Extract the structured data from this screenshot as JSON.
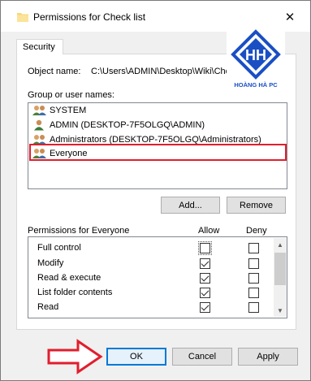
{
  "window": {
    "title": "Permissions for Check list",
    "close_glyph": "✕",
    "folder_icon": "folder-icon",
    "close_icon": "close-icon"
  },
  "tabs": [
    {
      "label": "Security"
    }
  ],
  "object": {
    "label": "Object name:",
    "value": "C:\\Users\\ADMIN\\Desktop\\Wiki\\Check l"
  },
  "groups": {
    "label": "Group or user names:",
    "items": [
      {
        "name": "SYSTEM",
        "icon": "users-icon"
      },
      {
        "name": "ADMIN (DESKTOP-7F5OLGQ\\ADMIN)",
        "icon": "user-icon"
      },
      {
        "name": "Administrators (DESKTOP-7F5OLGQ\\Administrators)",
        "icon": "users-icon"
      },
      {
        "name": "Everyone",
        "icon": "users-icon",
        "selected": true
      }
    ],
    "highlight_color": "#e11e2d"
  },
  "buttons": {
    "add": "Add...",
    "remove": "Remove",
    "ok": "OK",
    "cancel": "Cancel",
    "apply": "Apply"
  },
  "permissions": {
    "label": "Permissions for Everyone",
    "allow_header": "Allow",
    "deny_header": "Deny",
    "rows": [
      {
        "name": "Full control",
        "allow": false,
        "deny": false
      },
      {
        "name": "Modify",
        "allow": true,
        "deny": false
      },
      {
        "name": "Read & execute",
        "allow": true,
        "deny": false
      },
      {
        "name": "List folder contents",
        "allow": true,
        "deny": false
      },
      {
        "name": "Read",
        "allow": true,
        "deny": false
      }
    ]
  },
  "logo": {
    "monogram": "HH",
    "text": "HOÀNG HÀ PC",
    "color": "#1a4fc4"
  },
  "annotation": {
    "arrow_color": "#e11e2d"
  }
}
